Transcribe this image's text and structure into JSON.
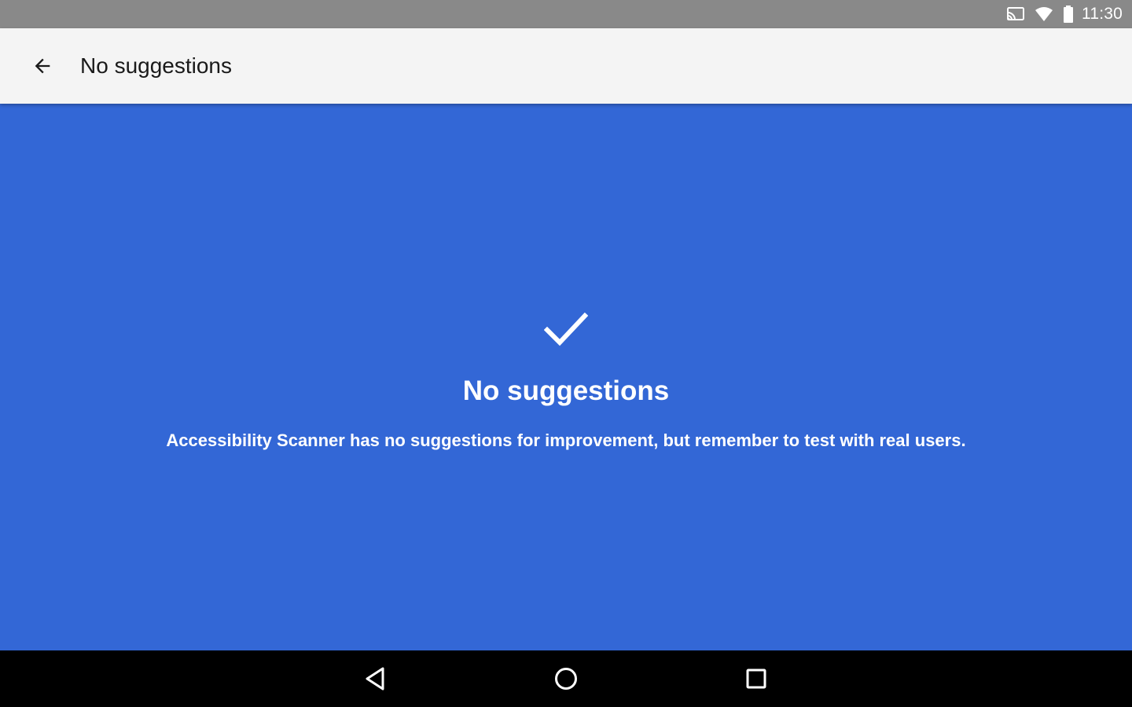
{
  "status_bar": {
    "time": "11:30",
    "icons": [
      "cast-icon",
      "wifi-icon",
      "battery-icon"
    ]
  },
  "app_bar": {
    "title": "No suggestions",
    "back_icon": "arrow-back-icon"
  },
  "main": {
    "icon": "check-icon",
    "title": "No suggestions",
    "message": "Accessibility Scanner has no suggestions for improvement, but remember to test with real users."
  },
  "nav_bar": {
    "buttons": [
      "back-triangle-icon",
      "home-circle-icon",
      "recents-square-icon"
    ]
  },
  "colors": {
    "status_bar": "#898989",
    "app_bar": "#f4f4f4",
    "main_background": "#3367d6",
    "nav_bar": "#000000",
    "text_on_main": "#ffffff"
  }
}
